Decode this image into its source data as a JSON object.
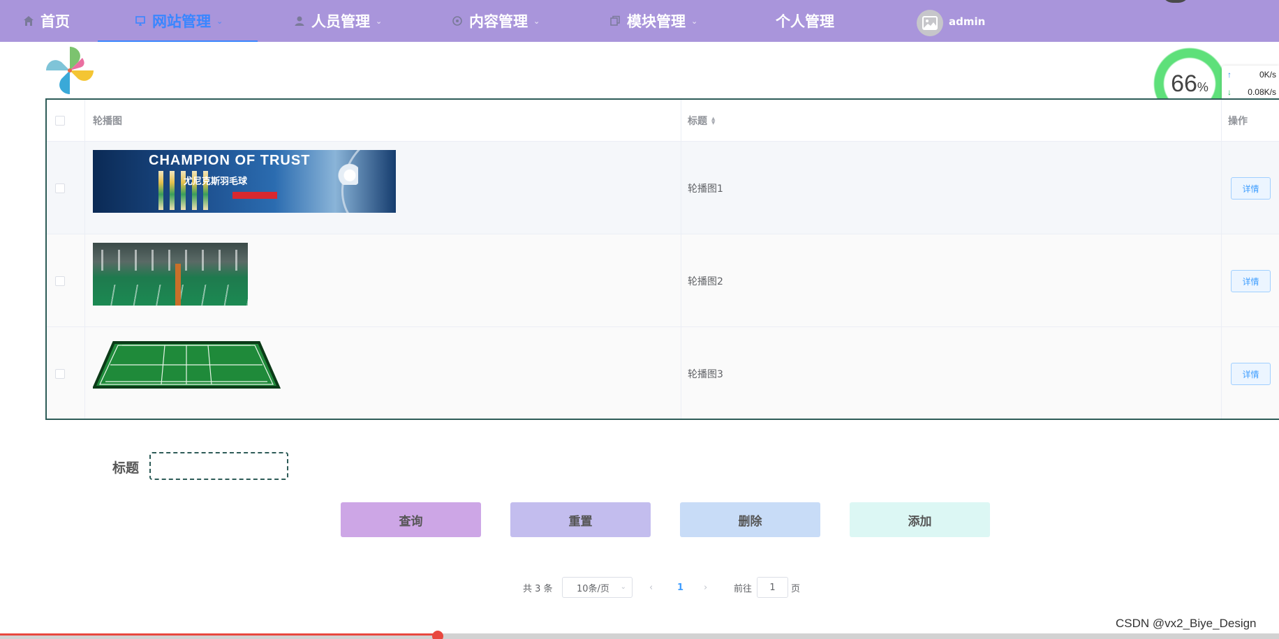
{
  "nav": {
    "items": [
      {
        "label": "首页",
        "icon": "home-icon"
      },
      {
        "label": "网站管理",
        "icon": "monitor-icon",
        "active": true
      },
      {
        "label": "人员管理",
        "icon": "user-icon"
      },
      {
        "label": "内容管理",
        "icon": "circle-icon"
      },
      {
        "label": "模块管理",
        "icon": "copy-icon"
      },
      {
        "label": "个人管理",
        "icon": ""
      }
    ],
    "user": "admin",
    "active_color": "#3a86ff",
    "bg_color": "#a995db"
  },
  "net_widget": {
    "percent": "66",
    "percent_unit": "%",
    "up_speed": "0K/s",
    "down_speed": "0.08K/s"
  },
  "table": {
    "headers": {
      "image": "轮播图",
      "title": "标题",
      "action": "操作"
    },
    "rows": [
      {
        "title": "轮播图1",
        "action": "详情",
        "banner_text": "CHAMPION OF TRUST",
        "banner_subtext": "尤尼克斯羽毛球"
      },
      {
        "title": "轮播图2",
        "action": "详情"
      },
      {
        "title": "轮播图3",
        "action": "详情"
      }
    ]
  },
  "form": {
    "title_label": "标题",
    "title_value": ""
  },
  "buttons": {
    "query": "查询",
    "reset": "重置",
    "delete": "删除",
    "add": "添加"
  },
  "pagination": {
    "total": "共 3 条",
    "page_size": "10条/页",
    "current_page": "1",
    "goto_label": "前往",
    "goto_value": "1",
    "page_suffix": "页"
  },
  "watermark": "CSDN @vx2_Biye_Design"
}
